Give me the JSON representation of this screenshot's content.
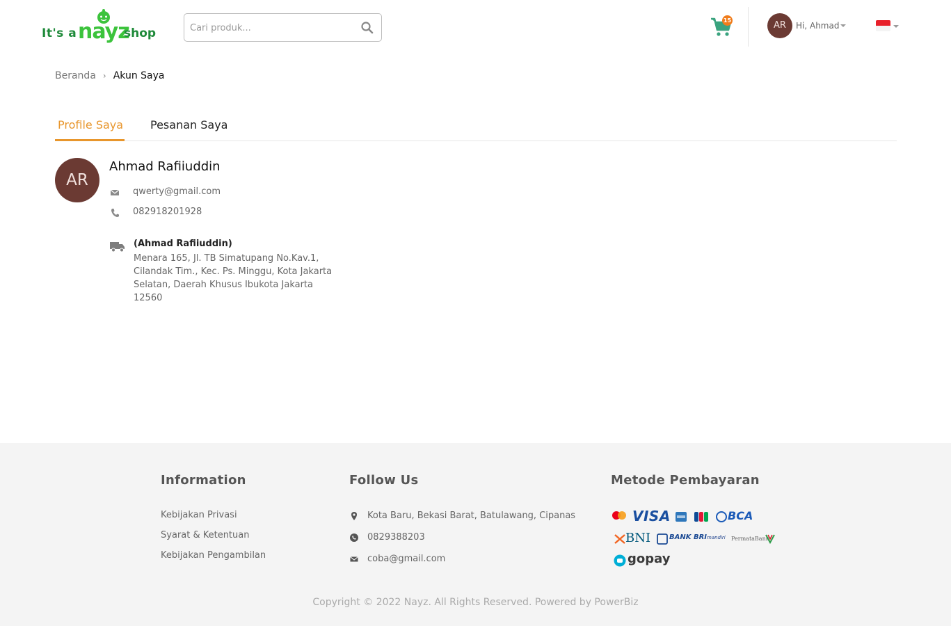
{
  "header": {
    "logo": {
      "prefix": "It's a",
      "brand": "nayz",
      "suffix": "shop"
    },
    "search": {
      "placeholder": "Cari produk..."
    },
    "cart": {
      "count": "15"
    },
    "user": {
      "initials": "AR",
      "greeting": "Hi, Ahmad"
    },
    "language": "id-flag"
  },
  "breadcrumb": {
    "home": "Beranda",
    "current": "Akun Saya"
  },
  "tabs": [
    {
      "label": "Profile Saya",
      "active": true
    },
    {
      "label": "Pesanan Saya",
      "active": false
    }
  ],
  "profile": {
    "initials": "AR",
    "name": "Ahmad Rafiiuddin",
    "email": "qwerty@gmail.com",
    "phone": "082918201928",
    "address": {
      "recipient": "(Ahmad Rafiiuddin)",
      "text": "Menara 165, Jl. TB Simatupang No.Kav.1, Cilandak Tim., Kec. Ps. Minggu, Kota Jakarta Selatan, Daerah Khusus Ibukota Jakarta 12560"
    }
  },
  "footer": {
    "information": {
      "title": "Information",
      "links": [
        "Kebijakan Privasi",
        "Syarat & Ketentuan",
        "Kebijakan Pengambilan"
      ]
    },
    "follow": {
      "title": "Follow Us",
      "address": "Kota Baru, Bekasi Barat, Batulawang, Cipanas",
      "whatsapp": "0829388203",
      "email": "coba@gmail.com"
    },
    "payment": {
      "title": "Metode Pembayaran",
      "methods": {
        "visa": "VISA",
        "bca": "BCA",
        "bni": "BNI",
        "bri": "BANK BRI",
        "mandiri": "mandiri",
        "permata": "PermataBank",
        "gopay": "gopay"
      }
    },
    "copyright": "Copyright © 2022 Nayz. All Rights Reserved. Powered by PowerBiz"
  },
  "colors": {
    "accent": "#e8962c",
    "avatar": "#6b3a33",
    "brand_green": "#3cc33c",
    "cart_badge": "#f07c1b"
  }
}
